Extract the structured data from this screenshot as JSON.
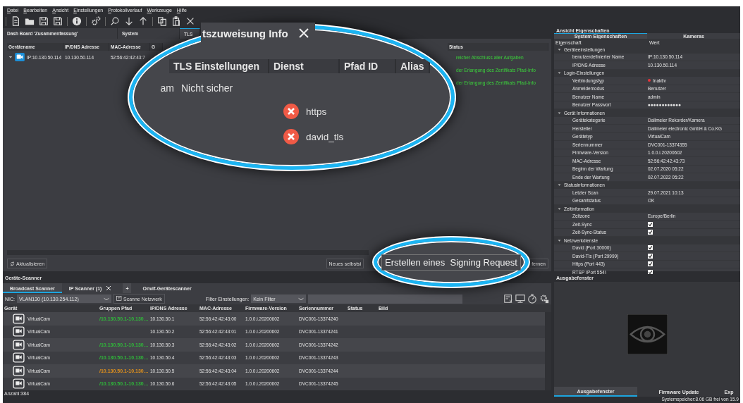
{
  "menu": [
    "Datei",
    "Bearbeiten",
    "Ansicht",
    "Einstellungen",
    "Protokollverlauf",
    "Werkzeuge",
    "Hilfe"
  ],
  "doc_tabs": [
    {
      "label": "Dash Board 'Zusammenfassung'",
      "selected": false
    },
    {
      "label": "System",
      "selected": false
    },
    {
      "label": "TLS",
      "selected": true
    }
  ],
  "device_table": {
    "columns": [
      "Gerätename",
      "IP/DNS Adresse",
      "MAC-Adresse",
      "G",
      "Status"
    ],
    "rows": [
      {
        "expanded": true,
        "name": "IP:10.130.50.114",
        "ip": "10.130.50.114",
        "mac": "52:56:42:42:43:7",
        "status": "reicher Abschluss aller Aufgaben"
      },
      {
        "status": "der Erlangung des Zertifikats Pfad-Info"
      },
      {
        "status": "der Erlangung des Zertifikats Pfad-Info"
      }
    ]
  },
  "doc_buttons": {
    "refresh": "Aktualisieren",
    "new_cert": "Neues selbstsi",
    "remove": "fernen"
  },
  "magnifier_tls": {
    "tab_title": "tszuweisung Info",
    "columns": [
      "TLS Einstellungen",
      "Dienst",
      "Pfad ID",
      "Alias"
    ],
    "row": {
      "column_1": "am",
      "tls": "Nicht sicher"
    },
    "services": [
      {
        "name": "https",
        "secure": false
      },
      {
        "name": "david_tls",
        "secure": false
      }
    ]
  },
  "magnifier_button": {
    "label": "Erstellen eines  Signing Request"
  },
  "scanner": {
    "title": "Geräte-Scanner",
    "tabs": [
      {
        "label": "Broadcast Scanner",
        "selected": true,
        "closable": false
      },
      {
        "label": "IP Scanner (1)",
        "selected": false,
        "closable": true
      },
      {
        "label": "+",
        "selected": false,
        "closable": false
      },
      {
        "label": "Onvif-Gerätescanner",
        "selected": false,
        "closable": false
      }
    ],
    "nic_label": "NIC:",
    "nic_value": "VLAN130 (10.130.254.112)",
    "scan_button": "Scanne Netzwerk",
    "filter_label": "Filter Einstellungen:",
    "filter_value": "Kein Filter",
    "columns": [
      "Gerät",
      "Gruppen Pfad",
      "IP/DNS Adresse",
      "MAC-Adresse",
      "Firmware-Version",
      "Seriennummer",
      "Status",
      "Bild"
    ],
    "rows": [
      {
        "device": "VirtualCam",
        "path": "/10.130.50.1-10.130…",
        "color": "#2fb83a",
        "ip": "10.130.50.1",
        "mac": "52:56:42:42:43:00",
        "firmware": "1.0.0.i.20200602",
        "serial": "DVC001-13374240"
      },
      {
        "device": "VirtualCam",
        "ip": "10.130.50.2",
        "mac": "52:56:42:42:43:01",
        "firmware": "1.0.0.i.20200602",
        "serial": "DVC001-13374241"
      },
      {
        "device": "VirtualCam",
        "path": "/10.130.50.1-10.130…",
        "color": "#2fb83a",
        "ip": "10.130.50.3",
        "mac": "52:56:42:42:43:02",
        "firmware": "1.0.0.i.20200602",
        "serial": "DVC001-13374242"
      },
      {
        "device": "VirtualCam",
        "path": "/10.130.50.1-10.130…",
        "color": "#2fb83a",
        "ip": "10.130.50.4",
        "mac": "52:56:42:42:43:03",
        "firmware": "1.0.0.i.20200602",
        "serial": "DVC001-13374243"
      },
      {
        "device": "VirtualCam",
        "path": "/10.130.50.1-10.130…",
        "color": "#e0901c",
        "ip": "10.130.50.5",
        "mac": "52:56:42:42:43:04",
        "firmware": "1.0.0.i.20200602",
        "serial": "DVC001-13374244"
      },
      {
        "device": "VirtualCam",
        "path": "/10.130.50.1-10.130…",
        "color": "#2fb83a",
        "ip": "10.130.50.6",
        "mac": "52:56:42:42:43:05",
        "firmware": "1.0.0.i.20200602",
        "serial": "DVC001-13374245"
      }
    ],
    "count": "Anzahl:384"
  },
  "properties": {
    "title": "Ansicht Eigenschaften",
    "tabs": [
      {
        "label": "System Eigenschaften",
        "selected": true
      },
      {
        "label": "Kameras",
        "selected": false
      }
    ],
    "columns": [
      "Eigenschaft",
      "Wert"
    ],
    "groups": [
      {
        "name": "Geräteeinstellungen",
        "expanded": true,
        "children": [
          {
            "kind": "text",
            "name": "benutzerdefinierter Name",
            "value": "IP:10.130.50.114"
          },
          {
            "kind": "text",
            "name": "IP/DNS Adresse",
            "value": "10.130.50.114"
          }
        ]
      },
      {
        "name": "Login-Einstellungen",
        "expanded": true,
        "children": [
          {
            "kind": "status",
            "name": "Verbindungstyp",
            "value": "Inaktiv",
            "color": "#e8343a"
          },
          {
            "kind": "text",
            "name": "Anmeldemodus",
            "value": "Benutzer"
          },
          {
            "kind": "text",
            "name": "Benutzer Name",
            "value": "admin"
          },
          {
            "kind": "text",
            "name": "Benutzer Passwort",
            "value": "●●●●●●●●●●●●"
          }
        ]
      },
      {
        "name": "Gerät Informationen",
        "expanded": true,
        "children": [
          {
            "kind": "text",
            "name": "Gerätekategorie",
            "value": "Dallmeier Rekorder/Kamera"
          },
          {
            "kind": "text",
            "name": "Hersteller",
            "value": "Dallmeier electronic GmbH & Co.KG"
          },
          {
            "kind": "text",
            "name": "Gerätetyp",
            "value": "VirtualCam"
          },
          {
            "kind": "text",
            "name": "Seriennummer",
            "value": "DVC001-13374355"
          },
          {
            "kind": "text",
            "name": "Firmware-Version",
            "value": "1.0.0.i.20200602"
          },
          {
            "kind": "text",
            "name": "MAC-Adresse",
            "value": "52:56:42:42:43:73"
          },
          {
            "kind": "text",
            "name": "Beginn der Wartung",
            "value": "02.07.2020 05:22"
          },
          {
            "kind": "text",
            "name": "Ende der Wartung",
            "value": "02.07.2022 05:22"
          }
        ]
      },
      {
        "name": "Statusinformationen",
        "expanded": true,
        "children": [
          {
            "kind": "text",
            "name": "Letzter Scan",
            "value": "29.07.2021 10:13"
          },
          {
            "kind": "text",
            "name": "Gesamtstatus",
            "value": "OK"
          }
        ]
      },
      {
        "name": "Zeitinformation",
        "expanded": true,
        "children": [
          {
            "kind": "text",
            "name": "Zeitzone",
            "value": "Europe/Berlin"
          },
          {
            "kind": "checkbox",
            "name": "Zeit-Sync",
            "checked": true
          },
          {
            "kind": "checkbox",
            "name": "Zeit-Sync-Status",
            "checked": true
          }
        ]
      },
      {
        "name": "Netzwerkdienste",
        "expanded": true,
        "children": [
          {
            "kind": "checkbox",
            "name": "David (Port 30000)",
            "checked": true
          },
          {
            "kind": "checkbox",
            "name": "David-Tls (Port 29999)",
            "checked": true
          },
          {
            "kind": "checkbox",
            "name": "Https (Port 443)",
            "checked": true
          },
          {
            "kind": "checkbox",
            "name": "RTSP (Port 554)",
            "checked": true
          }
        ]
      }
    ]
  },
  "output": {
    "title": "Ausgabefenster",
    "tabs": [
      {
        "label": "Ausgabefenster",
        "selected": true
      },
      {
        "label": "Firmware Update",
        "selected": false
      },
      {
        "label": "Exp",
        "selected": false
      }
    ]
  },
  "status_bar": {
    "text": "Systemspeicher:8.06 GB frei von 15.9"
  }
}
